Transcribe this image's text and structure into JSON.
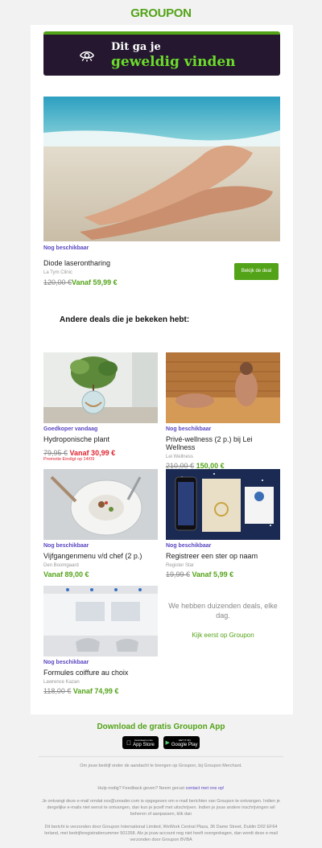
{
  "header": {
    "logo": "GROUPON"
  },
  "banner": {
    "line1": "Dit ga je",
    "line2": "geweldig vinden"
  },
  "hero": {
    "availability": "Nog beschikbaar",
    "title": "Diode laserontharing",
    "merchant": "La Tym Clinic",
    "old_price": "120,00 €",
    "new_price": "Vanaf 59,99 €",
    "button": "Bekijk de deal"
  },
  "section_title": "Andere deals die je bekeken hebt:",
  "deals": [
    {
      "availability": "Goedkoper vandaag",
      "title": "Hydroponische plant",
      "merchant": "",
      "old_price": "79,95 €",
      "new_price": "Vanaf 30,99 €",
      "promo": "Promotie Eindigt op 14/09"
    },
    {
      "availability": "Nog beschikbaar",
      "title": "Privé-wellness (2 p.) bij Lei Wellness",
      "merchant": "Lei Wellness",
      "old_price": "210,00 €",
      "new_price": "150,00 €",
      "promo": ""
    },
    {
      "availability": "Nog beschikbaar",
      "title": "Vijfgangenmenu v/d chef (2 p.)",
      "merchant": "Den Boomgaard",
      "old_price": "",
      "new_price": "Vanaf 89,00 €",
      "promo": ""
    },
    {
      "availability": "Nog beschikbaar",
      "title": "Registreer een ster op naam",
      "merchant": "Register Star",
      "old_price": "19,99 €",
      "new_price": "Vanaf 5,99 €",
      "promo": ""
    },
    {
      "availability": "Nog beschikbaar",
      "title": "Formules coiffure au choix",
      "merchant": "Lawrence Kazan",
      "old_price": "118,00 €",
      "new_price": "Vanaf 74,99 €",
      "promo": ""
    }
  ],
  "more": {
    "text": "We hebben duizenden deals, elke dag.",
    "link": "Kijk eerst op Groupon"
  },
  "footer": {
    "app_title": "Download de gratis Groupon App",
    "app_store_small": "Download on the",
    "app_store": "App Store",
    "play_small": "GET IT ON",
    "play": "Google Play",
    "merchant_note": "Om jouw bedrijf onder de aandacht te brengen op Groupon, bij Groupon Merchant.",
    "help": "Hulp nodig? Feedback geven? Neem gerust",
    "help_link": "contact met ons op!",
    "legal1": "Je ontvangt deze e-mail omdat xxx@ureader.com is opgegeven om e-mail berichten van Groupon te ontvangen. Indien je dergelijke e-mails niet wenst te ontvangen, dan kun je jezelf met uitschrijven. Indien je jouw andere inschrijvingen wil beheren of aanpassen, klik dan",
    "legal2": "Dit bericht is verzonden door Groupon International Limited, WeWork Central Plaza, 36 Dame Street, Dublin D02 EF64 Ierland, met bedrijfsregistratienummer 501358. Als je jouw account nog niet heeft overgedragen, dan wordt deze e-mail verzonden door Groupon BVBA"
  },
  "colors": {
    "brand_green": "#53a318",
    "banner_bg": "#25172f",
    "accent_purple": "#5a48c2",
    "promo_red": "#e0232f"
  }
}
